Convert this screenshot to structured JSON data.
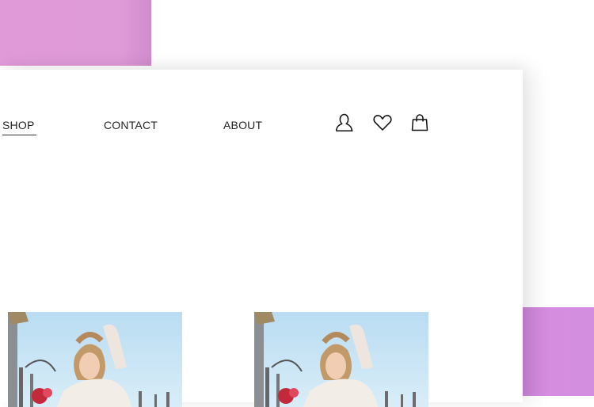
{
  "nav": {
    "shop": "SHOP",
    "contact": "CONTACT",
    "about": "ABOUT"
  },
  "icons": {
    "account": "user-icon",
    "wishlist": "heart-icon",
    "cart": "shopping-bag-icon"
  },
  "products": [
    {
      "image": "model-in-white-jacket-photo"
    },
    {
      "image": "model-in-white-jacket-photo"
    }
  ],
  "colors": {
    "accent_pink": "#df9ad8",
    "accent_purple": "#d48ee0",
    "text": "#222222",
    "sky": "#bfe0f4"
  }
}
